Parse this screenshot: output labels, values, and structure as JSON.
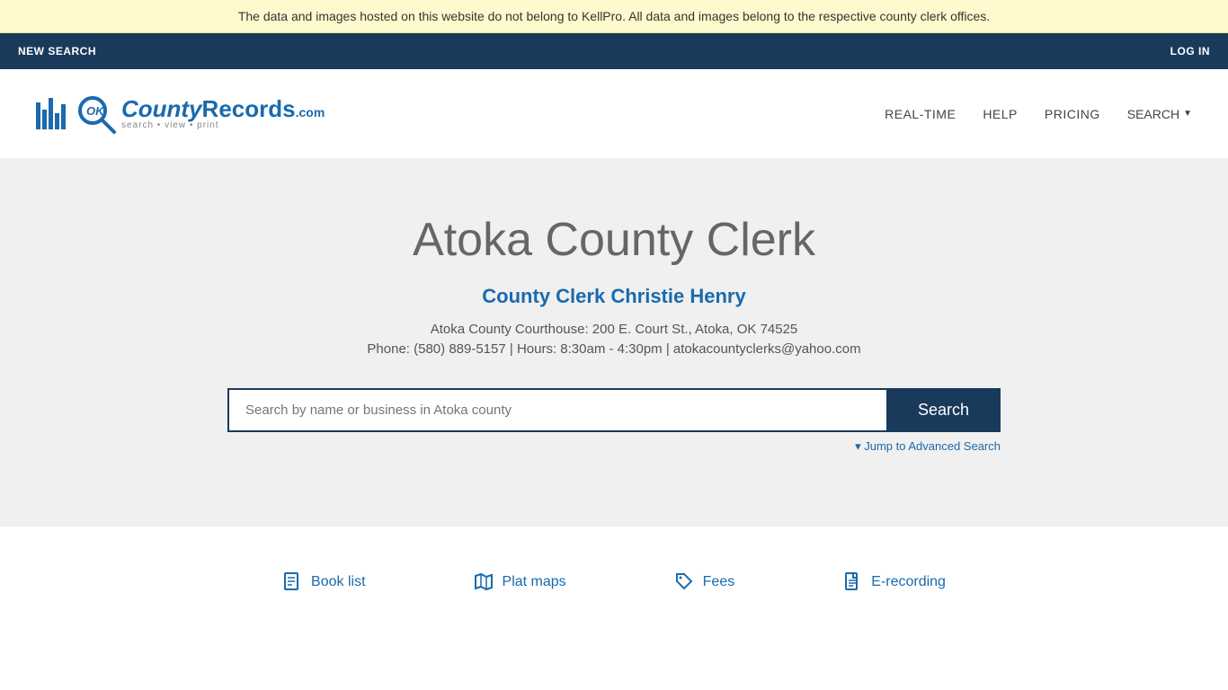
{
  "banner": {
    "text": "The data and images hosted on this website do not belong to KellPro. All data and images belong to the respective county clerk offices."
  },
  "topnav": {
    "new_search_label": "NEW SEARCH",
    "login_label": "LOG IN"
  },
  "header": {
    "logo_brand": "OKCountyRecords",
    "logo_tld": ".com",
    "logo_tagline": "search • view • print",
    "nav": {
      "realtime": "REAL-TIME",
      "help": "HELP",
      "pricing": "PRICING",
      "search": "SEARCH"
    }
  },
  "hero": {
    "title": "Atoka County Clerk",
    "clerk_name": "County Clerk Christie Henry",
    "address": "Atoka County Courthouse: 200 E. Court St., Atoka, OK 74525",
    "contact": "Phone: (580) 889-5157 | Hours: 8:30am - 4:30pm | atokacountyclerks@yahoo.com",
    "search_placeholder": "Search by name or business in Atoka county",
    "search_button": "Search",
    "advanced_search_label": "▾ Jump to Advanced Search"
  },
  "footer_links": [
    {
      "icon": "book-icon",
      "label": "Book list",
      "unicode": "📋"
    },
    {
      "icon": "map-icon",
      "label": "Plat maps",
      "unicode": "🗺"
    },
    {
      "icon": "tag-icon",
      "label": "Fees",
      "unicode": "🏷"
    },
    {
      "icon": "document-icon",
      "label": "E-recording",
      "unicode": "📄"
    }
  ],
  "colors": {
    "accent_blue": "#1a6aad",
    "dark_navy": "#1a3a5c",
    "background_gray": "#f0f0f0",
    "banner_yellow": "#fffacd"
  }
}
